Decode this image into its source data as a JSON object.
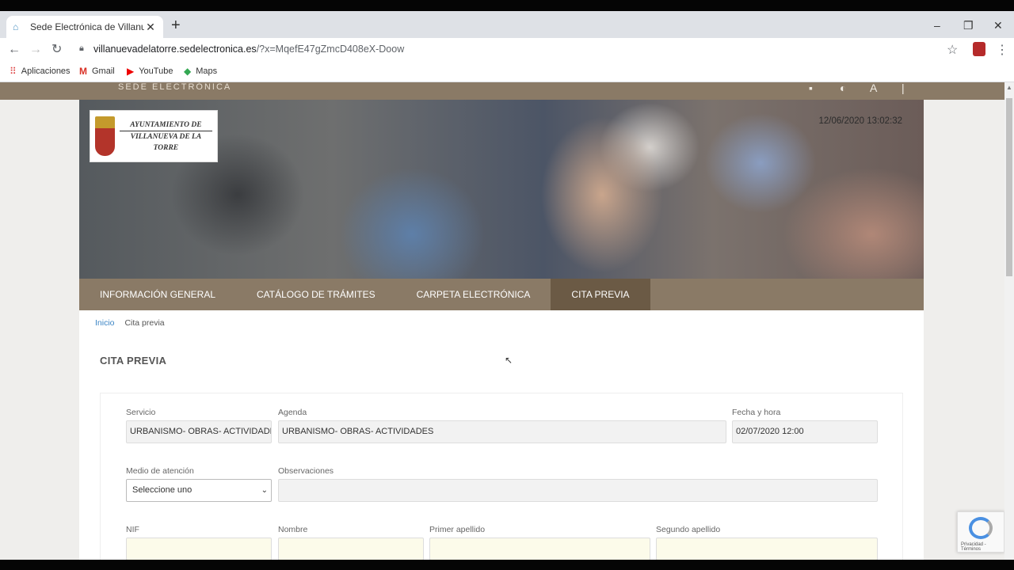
{
  "browser": {
    "tab_title": "Sede Electrónica de Villanueva de la Torre",
    "url_domain": "villanuevadelatorre.sedelectronica.es",
    "url_rest": "/?x=MqefE47gZmcD408eX-Doow",
    "bookmarks": [
      {
        "label": "Aplicaciones",
        "icon": "apps-grid-icon"
      },
      {
        "label": "Gmail",
        "icon": "gmail-icon"
      },
      {
        "label": "YouTube",
        "icon": "youtube-icon"
      },
      {
        "label": "Maps",
        "icon": "maps-icon"
      }
    ]
  },
  "site": {
    "header_label": "SEDE ELECTRÓNICA",
    "logo_line1": "AYUNTAMIENTO DE",
    "logo_line2": "VILLANUEVA DE LA TORRE",
    "datetime": "12/06/2020 13:02:32",
    "nav": [
      {
        "label": "INFORMACIÓN GENERAL",
        "active": false
      },
      {
        "label": "CATÁLOGO DE TRÁMITES",
        "active": false
      },
      {
        "label": "CARPETA ELECTRÓNICA",
        "active": false
      },
      {
        "label": "CITA PREVIA",
        "active": true
      }
    ],
    "accent_color": "#8a7a66"
  },
  "breadcrumb": {
    "home": "Inicio",
    "current": "Cita previa"
  },
  "page_title": "CITA PREVIA",
  "form": {
    "servicio": {
      "label": "Servicio",
      "value": "URBANISMO- OBRAS- ACTIVIDADES"
    },
    "agenda": {
      "label": "Agenda",
      "value": "URBANISMO- OBRAS- ACTIVIDADES"
    },
    "fecha": {
      "label": "Fecha y hora",
      "value": "02/07/2020 12:00"
    },
    "medio": {
      "label": "Medio de atención",
      "value": "Seleccione uno"
    },
    "observaciones": {
      "label": "Observaciones",
      "value": ""
    },
    "nif": {
      "label": "NIF",
      "value": ""
    },
    "nombre": {
      "label": "Nombre",
      "value": ""
    },
    "apellido1": {
      "label": "Primer apellido",
      "value": ""
    },
    "apellido2": {
      "label": "Segundo apellido",
      "value": ""
    }
  },
  "recaptcha": {
    "footer": "Privacidad - Términos"
  }
}
